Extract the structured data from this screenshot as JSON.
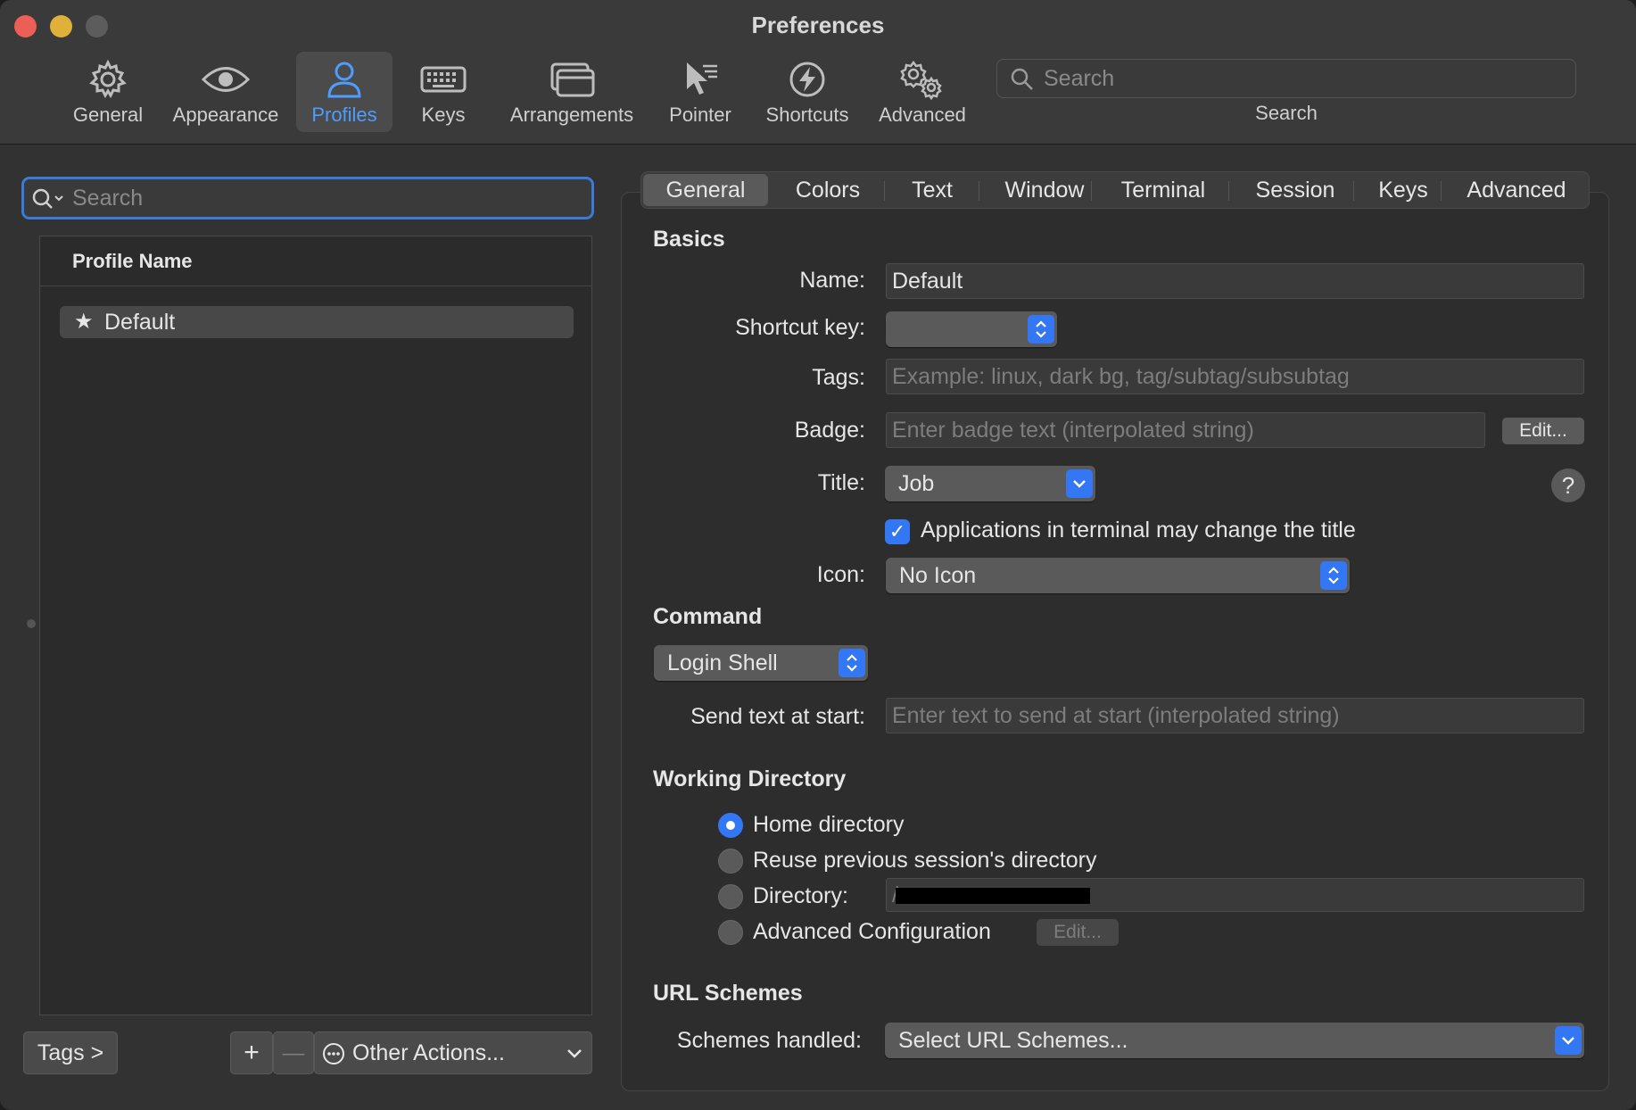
{
  "window": {
    "title": "Preferences"
  },
  "toolbar": {
    "items": [
      {
        "label": "General",
        "icon": "gear-icon"
      },
      {
        "label": "Appearance",
        "icon": "eye-icon"
      },
      {
        "label": "Profiles",
        "icon": "person-icon",
        "selected": true
      },
      {
        "label": "Keys",
        "icon": "keyboard-icon"
      },
      {
        "label": "Arrangements",
        "icon": "windows-icon"
      },
      {
        "label": "Pointer",
        "icon": "pointer-icon"
      },
      {
        "label": "Shortcuts",
        "icon": "lightning-icon"
      },
      {
        "label": "Advanced",
        "icon": "gears-icon"
      }
    ],
    "search": {
      "placeholder": "Search",
      "label": "Search"
    }
  },
  "profiles": {
    "search_placeholder": "Search",
    "column_header": "Profile Name",
    "items": [
      {
        "name": "Default",
        "default": true
      }
    ],
    "tags_button": "Tags >",
    "add_label": "+",
    "remove_label": "—",
    "other_actions": "Other Actions..."
  },
  "tabs": [
    "General",
    "Colors",
    "Text",
    "Window",
    "Terminal",
    "Session",
    "Keys",
    "Advanced"
  ],
  "basics": {
    "heading": "Basics",
    "name_label": "Name:",
    "name_value": "Default",
    "shortcut_label": "Shortcut key:",
    "shortcut_value": "",
    "tags_label": "Tags:",
    "tags_placeholder": "Example: linux, dark bg, tag/subtag/subsubtag",
    "badge_label": "Badge:",
    "badge_placeholder": "Enter badge text (interpolated string)",
    "badge_edit": "Edit...",
    "title_label": "Title:",
    "title_value": "Job",
    "help": "?",
    "apps_change_title": "Applications in terminal may change the title",
    "apps_change_title_checked": true,
    "icon_label": "Icon:",
    "icon_value": "No Icon"
  },
  "command": {
    "heading": "Command",
    "shell_value": "Login Shell",
    "send_text_label": "Send text at start:",
    "send_text_placeholder": "Enter text to send at start (interpolated string)"
  },
  "working_directory": {
    "heading": "Working Directory",
    "options": [
      {
        "label": "Home directory",
        "selected": true
      },
      {
        "label": "Reuse previous session's directory",
        "selected": false
      },
      {
        "label": "Directory:",
        "selected": false
      },
      {
        "label": "Advanced Configuration",
        "selected": false
      }
    ],
    "directory_value": "/",
    "advanced_edit": "Edit..."
  },
  "url_schemes": {
    "heading": "URL Schemes",
    "label": "Schemes handled:",
    "value": "Select URL Schemes..."
  },
  "colors": {
    "accent": "#3477f5",
    "selected_toolbar_label": "#4d9dff",
    "close": "#ec5f57",
    "minimize": "#e0b03a",
    "zoom": "#5c5c5c"
  }
}
